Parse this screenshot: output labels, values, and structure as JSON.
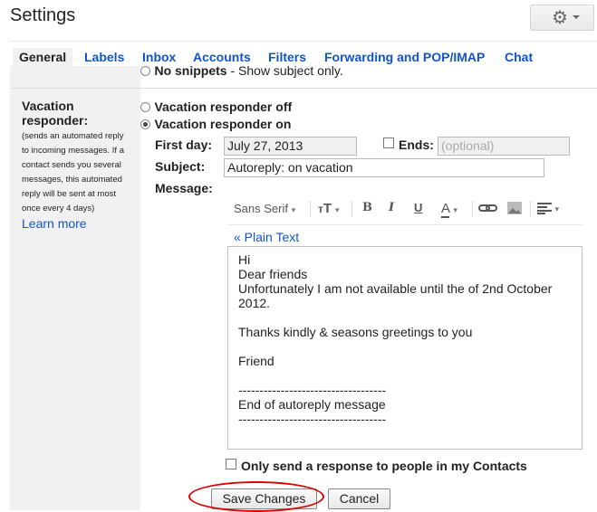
{
  "header": {
    "title": "Settings"
  },
  "tabs": [
    {
      "label": "General"
    },
    {
      "label": "Labels"
    },
    {
      "label": "Inbox"
    },
    {
      "label": "Accounts"
    },
    {
      "label": "Filters"
    },
    {
      "label": "Forwarding and POP/IMAP"
    },
    {
      "label": "Chat"
    }
  ],
  "snippets": {
    "label": "No snippets",
    "desc": " - Show subject only."
  },
  "vacation": {
    "title": "Vacation responder:",
    "desc": "(sends an automated reply to incoming messages. If a contact sends you several messages, this automated reply will be sent at most once every 4 days)",
    "learn_more": "Learn more",
    "off_label": "Vacation responder off",
    "on_label": "Vacation responder on",
    "first_day_label": "First day:",
    "first_day_value": "July 27, 2013",
    "ends_label": "Ends:",
    "ends_placeholder": "(optional)",
    "subject_label": "Subject:",
    "subject_value": "Autoreply: on vacation",
    "message_label": "Message:"
  },
  "toolbar": {
    "font": "Sans Serif",
    "bold": "B",
    "italic": "I",
    "underline": "U",
    "text_color": "A"
  },
  "plain_text": "« Plain Text",
  "message_lines": [
    "Hi",
    "Dear friends",
    "Unfortunately I am not available until the of 2nd October",
    "2012.",
    "",
    "Thanks kindly & seasons greetings to you",
    "",
    "Friend",
    "",
    "-----------------------------------",
    "End of autoreply message",
    "-----------------------------------"
  ],
  "contacts_only": "Only send a response to people in my Contacts",
  "buttons": {
    "save": "Save Changes",
    "cancel": "Cancel"
  }
}
